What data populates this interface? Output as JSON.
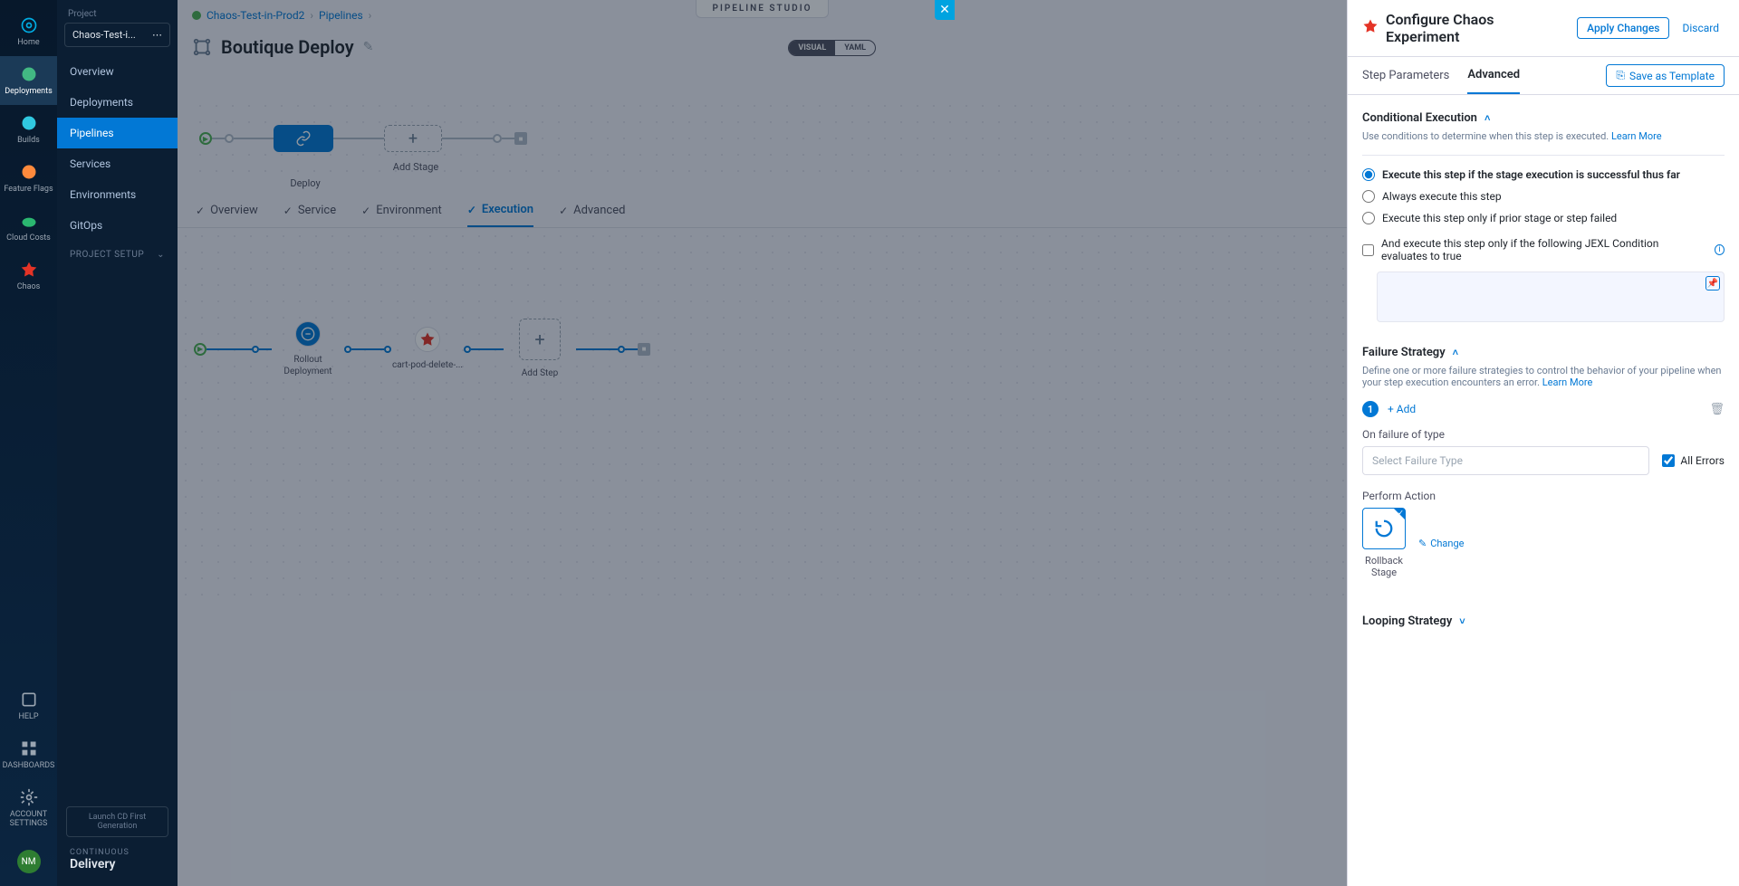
{
  "nav": {
    "home": "Home",
    "deployments": "Deployments",
    "builds": "Builds",
    "feature_flags": "Feature Flags",
    "cloud_costs": "Cloud Costs",
    "chaos": "Chaos",
    "help": "HELP",
    "dashboards": "DASHBOARDS",
    "account_settings": "ACCOUNT SETTINGS",
    "avatar": "NM"
  },
  "proj": {
    "label": "Project",
    "name": "Chaos-Test-i...",
    "items": [
      "Overview",
      "Deployments",
      "Pipelines",
      "Services",
      "Environments",
      "GitOps"
    ],
    "setup": "PROJECT SETUP",
    "launch": "Launch CD First Generation",
    "brand_top": "CONTINUOUS",
    "brand_bot": "Delivery"
  },
  "crumb": {
    "proj": "Chaos-Test-in-Prod2",
    "pipelines": "Pipelines"
  },
  "studio": "PIPELINE STUDIO",
  "view": {
    "visual": "VISUAL",
    "yaml": "YAML"
  },
  "title": "Boutique Deploy",
  "stage": {
    "deploy": "Deploy",
    "add": "Add Stage"
  },
  "tabs": [
    "Overview",
    "Service",
    "Environment",
    "Execution",
    "Advanced"
  ],
  "steps": {
    "rollout": "Rollout Deployment",
    "chaos": "cart-pod-delete-...",
    "add": "Add Step"
  },
  "panel": {
    "title": "Configure Chaos Experiment",
    "apply": "Apply Changes",
    "discard": "Discard",
    "tab_params": "Step Parameters",
    "tab_adv": "Advanced",
    "save_tpl": "Save as Template",
    "cond": {
      "title": "Conditional Execution",
      "help": "Use conditions to determine when this step is executed.",
      "learn": "Learn More",
      "r1": "Execute this step if the stage execution is successful thus far",
      "r2": "Always execute this step",
      "r3": "Execute this step only if prior stage or step failed",
      "jexl": "And execute this step only if the following JEXL Condition evaluates to true"
    },
    "fail": {
      "title": "Failure Strategy",
      "help": "Define one or more failure strategies to control the behavior of your pipeline when your step execution encounters an error.",
      "learn": "Learn More",
      "add": "+ Add",
      "on_fail": "On failure of type",
      "placeholder": "Select Failure Type",
      "all_err": "All Errors",
      "perform": "Perform Action",
      "rollback": "Rollback Stage",
      "change": "Change"
    },
    "loop": {
      "title": "Looping Strategy"
    }
  }
}
